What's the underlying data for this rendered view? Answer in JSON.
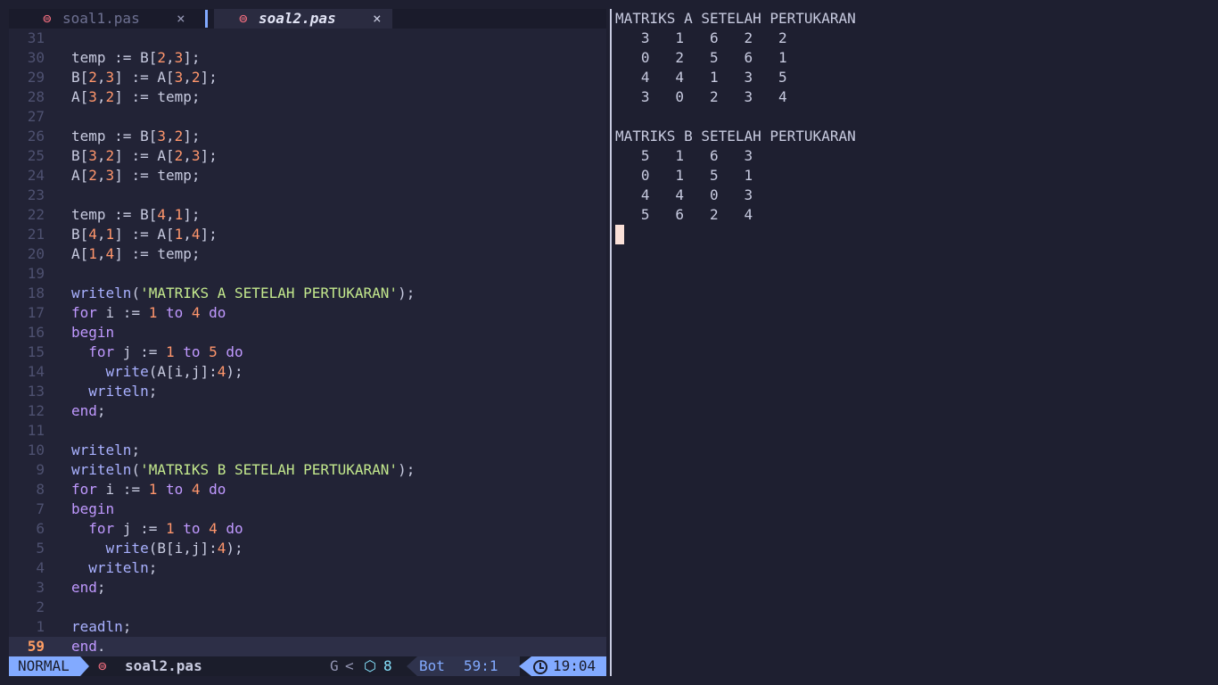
{
  "tabs": [
    {
      "icon": "pascal-icon",
      "label": "soal1.pas",
      "close": "×",
      "active": false
    },
    {
      "icon": "pascal-icon",
      "label": "soal2.pas",
      "close": "×",
      "active": true
    }
  ],
  "code_lines": [
    {
      "num": "31",
      "tokens": []
    },
    {
      "num": "30",
      "tokens": [
        [
          "pl",
          "temp := B["
        ],
        [
          "num",
          "2"
        ],
        [
          "pl",
          ","
        ],
        [
          "num",
          "3"
        ],
        [
          "pl",
          "];"
        ]
      ]
    },
    {
      "num": "29",
      "tokens": [
        [
          "pl",
          "B["
        ],
        [
          "num",
          "2"
        ],
        [
          "pl",
          ","
        ],
        [
          "num",
          "3"
        ],
        [
          "pl",
          "] := A["
        ],
        [
          "num",
          "3"
        ],
        [
          "pl",
          ","
        ],
        [
          "num",
          "2"
        ],
        [
          "pl",
          "];"
        ]
      ]
    },
    {
      "num": "28",
      "tokens": [
        [
          "pl",
          "A["
        ],
        [
          "num",
          "3"
        ],
        [
          "pl",
          ","
        ],
        [
          "num",
          "2"
        ],
        [
          "pl",
          "] := temp;"
        ]
      ]
    },
    {
      "num": "27",
      "tokens": []
    },
    {
      "num": "26",
      "tokens": [
        [
          "pl",
          "temp := B["
        ],
        [
          "num",
          "3"
        ],
        [
          "pl",
          ","
        ],
        [
          "num",
          "2"
        ],
        [
          "pl",
          "];"
        ]
      ]
    },
    {
      "num": "25",
      "tokens": [
        [
          "pl",
          "B["
        ],
        [
          "num",
          "3"
        ],
        [
          "pl",
          ","
        ],
        [
          "num",
          "2"
        ],
        [
          "pl",
          "] := A["
        ],
        [
          "num",
          "2"
        ],
        [
          "pl",
          ","
        ],
        [
          "num",
          "3"
        ],
        [
          "pl",
          "];"
        ]
      ]
    },
    {
      "num": "24",
      "tokens": [
        [
          "pl",
          "A["
        ],
        [
          "num",
          "2"
        ],
        [
          "pl",
          ","
        ],
        [
          "num",
          "3"
        ],
        [
          "pl",
          "] := temp;"
        ]
      ]
    },
    {
      "num": "23",
      "tokens": []
    },
    {
      "num": "22",
      "tokens": [
        [
          "pl",
          "temp := B["
        ],
        [
          "num",
          "4"
        ],
        [
          "pl",
          ","
        ],
        [
          "num",
          "1"
        ],
        [
          "pl",
          "];"
        ]
      ]
    },
    {
      "num": "21",
      "tokens": [
        [
          "pl",
          "B["
        ],
        [
          "num",
          "4"
        ],
        [
          "pl",
          ","
        ],
        [
          "num",
          "1"
        ],
        [
          "pl",
          "] := A["
        ],
        [
          "num",
          "1"
        ],
        [
          "pl",
          ","
        ],
        [
          "num",
          "4"
        ],
        [
          "pl",
          "];"
        ]
      ]
    },
    {
      "num": "20",
      "tokens": [
        [
          "pl",
          "A["
        ],
        [
          "num",
          "1"
        ],
        [
          "pl",
          ","
        ],
        [
          "num",
          "4"
        ],
        [
          "pl",
          "] := temp;"
        ]
      ]
    },
    {
      "num": "19",
      "tokens": []
    },
    {
      "num": "18",
      "tokens": [
        [
          "fn",
          "writeln"
        ],
        [
          "pl",
          "("
        ],
        [
          "str",
          "'MATRIKS A SETELAH PERTUKARAN'"
        ],
        [
          "pl",
          ");"
        ]
      ]
    },
    {
      "num": "17",
      "tokens": [
        [
          "kw",
          "for"
        ],
        [
          "pl",
          " i := "
        ],
        [
          "num",
          "1"
        ],
        [
          "kw",
          " to "
        ],
        [
          "num",
          "4"
        ],
        [
          "kw",
          " do"
        ]
      ]
    },
    {
      "num": "16",
      "tokens": [
        [
          "kw",
          "begin"
        ]
      ]
    },
    {
      "num": "15",
      "tokens": [
        [
          "pl",
          "  "
        ],
        [
          "kw",
          "for"
        ],
        [
          "pl",
          " j := "
        ],
        [
          "num",
          "1"
        ],
        [
          "kw",
          " to "
        ],
        [
          "num",
          "5"
        ],
        [
          "kw",
          " do"
        ]
      ]
    },
    {
      "num": "14",
      "tokens": [
        [
          "pl",
          "    "
        ],
        [
          "fn",
          "write"
        ],
        [
          "pl",
          "(A[i,j]:"
        ],
        [
          "num",
          "4"
        ],
        [
          "pl",
          ");"
        ]
      ]
    },
    {
      "num": "13",
      "tokens": [
        [
          "pl",
          "  "
        ],
        [
          "fn",
          "writeln"
        ],
        [
          "pl",
          ";"
        ]
      ]
    },
    {
      "num": "12",
      "tokens": [
        [
          "kw",
          "end"
        ],
        [
          "pl",
          ";"
        ]
      ]
    },
    {
      "num": "11",
      "tokens": []
    },
    {
      "num": "10",
      "tokens": [
        [
          "fn",
          "writeln"
        ],
        [
          "pl",
          ";"
        ]
      ]
    },
    {
      "num": "9",
      "tokens": [
        [
          "fn",
          "writeln"
        ],
        [
          "pl",
          "("
        ],
        [
          "str",
          "'MATRIKS B SETELAH PERTUKARAN'"
        ],
        [
          "pl",
          ");"
        ]
      ]
    },
    {
      "num": "8",
      "tokens": [
        [
          "kw",
          "for"
        ],
        [
          "pl",
          " i := "
        ],
        [
          "num",
          "1"
        ],
        [
          "kw",
          " to "
        ],
        [
          "num",
          "4"
        ],
        [
          "kw",
          " do"
        ]
      ]
    },
    {
      "num": "7",
      "tokens": [
        [
          "kw",
          "begin"
        ]
      ]
    },
    {
      "num": "6",
      "tokens": [
        [
          "pl",
          "  "
        ],
        [
          "kw",
          "for"
        ],
        [
          "pl",
          " j := "
        ],
        [
          "num",
          "1"
        ],
        [
          "kw",
          " to "
        ],
        [
          "num",
          "4"
        ],
        [
          "kw",
          " do"
        ]
      ]
    },
    {
      "num": "5",
      "tokens": [
        [
          "pl",
          "    "
        ],
        [
          "fn",
          "write"
        ],
        [
          "pl",
          "(B[i,j]:"
        ],
        [
          "num",
          "4"
        ],
        [
          "pl",
          ");"
        ]
      ]
    },
    {
      "num": "4",
      "tokens": [
        [
          "pl",
          "  "
        ],
        [
          "fn",
          "writeln"
        ],
        [
          "pl",
          ";"
        ]
      ]
    },
    {
      "num": "3",
      "tokens": [
        [
          "kw",
          "end"
        ],
        [
          "pl",
          ";"
        ]
      ]
    },
    {
      "num": "2",
      "tokens": []
    },
    {
      "num": "1",
      "tokens": [
        [
          "fn",
          "readln"
        ],
        [
          "pl",
          ";"
        ]
      ]
    },
    {
      "num": "59",
      "tokens": [
        [
          "kw",
          "end"
        ],
        [
          "pl",
          "."
        ]
      ],
      "current": true
    }
  ],
  "statusbar": {
    "mode": "NORMAL",
    "file_icon": "pascal-icon",
    "filename": "soal2.pas",
    "git": "G",
    "chevron": "<",
    "lsp_icon": "cube-icon",
    "lsp_count": "8",
    "scroll": "Bot",
    "position": "59:1",
    "clock_icon": "clock-icon",
    "time": "19:04"
  },
  "terminal_lines": [
    "MATRIKS A SETELAH PERTUKARAN",
    "   3   1   6   2   2",
    "   0   2   5   6   1",
    "   4   4   1   3   5",
    "   3   0   2   3   4",
    "",
    "MATRIKS B SETELAH PERTUKARAN",
    "   5   1   6   3",
    "   0   1   5   1",
    "   4   4   0   3",
    "   5   6   2   4"
  ],
  "colors": {
    "accent": "#82aaff",
    "keyword": "#c099ff",
    "number": "#ff966c",
    "string": "#c3e88d",
    "current_line_number": "#ff9e64"
  }
}
